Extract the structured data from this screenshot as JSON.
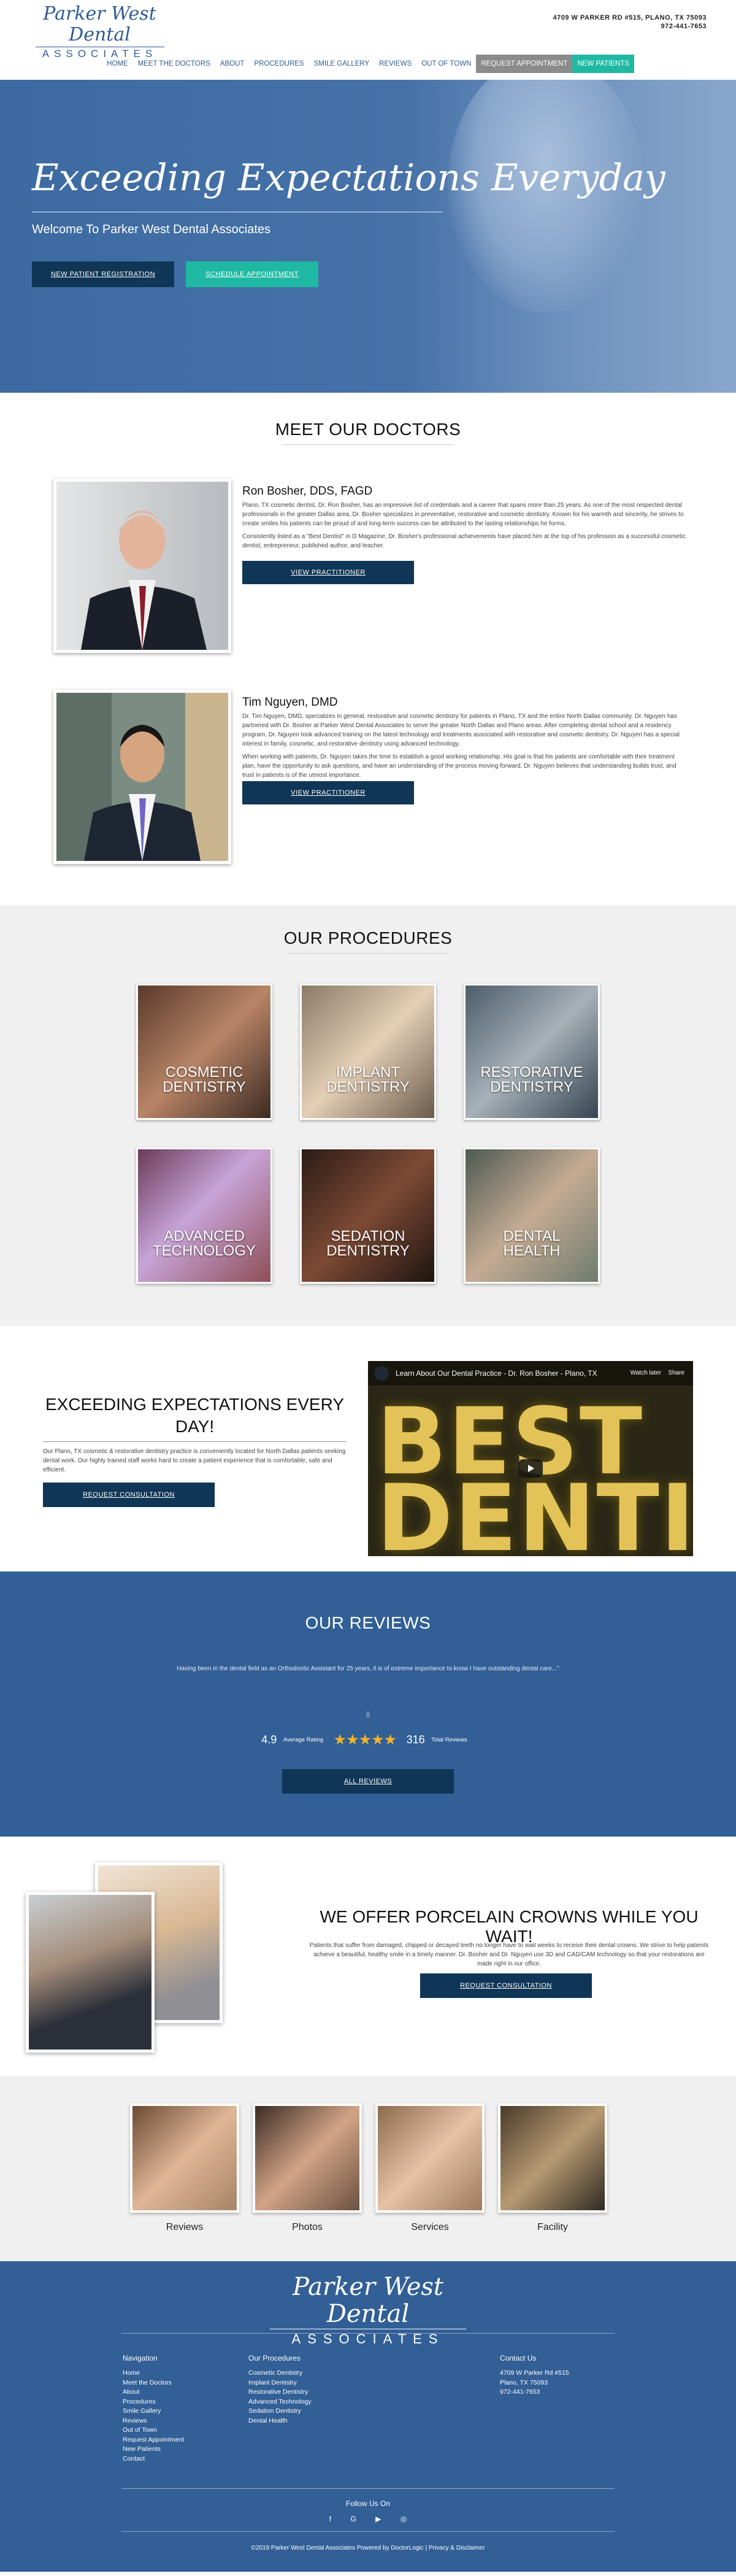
{
  "header": {
    "logo_script": "Parker West Dental",
    "logo_caps": "ASSOCIATES",
    "address_line1": "4709 W PARKER RD #515, PLANO, TX 75093",
    "phone": "972-441-7653"
  },
  "nav": {
    "items": [
      "HOME",
      "MEET THE DOCTORS",
      "ABOUT",
      "PROCEDURES",
      "SMILE GALLERY",
      "REVIEWS",
      "OUT OF TOWN"
    ],
    "request_appointment": "REQUEST APPOINTMENT",
    "new_patients": "NEW PATIENTS"
  },
  "hero": {
    "title": "Exceeding Expectations Everyday",
    "subtitle": "Welcome To Parker West Dental Associates",
    "btn_registration": "NEW PATIENT REGISTRATION",
    "btn_schedule": "SCHEDULE APPOINTMENT"
  },
  "doctors": {
    "title": "MEET OUR DOCTORS",
    "list": [
      {
        "name": "Ron Bosher, DDS, FAGD",
        "bio1": "Plano, TX cosmetic dentist, Dr. Ron Bosher, has an impressive list of credentials and a career that spans more than 25 years. As one of the most respected dental professionals in the greater Dallas area, Dr. Bosher specializes in preventative, restorative and cosmetic dentistry. Known for his warmth and sincerity, he strives to create smiles his patients can be proud of and long-term success can be attributed to the lasting relationships he forms.",
        "bio2": "Consistently listed as a \"Best Dentist\" in D Magazine, Dr. Bosher's professional achievements have placed him at the top of his profession as a successful cosmetic dentist, entrepreneur, published author, and teacher.",
        "button": "VIEW PRACTITIONER"
      },
      {
        "name": "Tim Nguyen, DMD",
        "bio1": "Dr. Tim Nguyen, DMD, specializes in general, restorative and cosmetic dentistry for patients in Plano, TX and the entire North Dallas community. Dr. Nguyen has partnered with Dr. Bosher at Parker West Dental Associates to serve the greater North Dallas and Plano areas. After completing dental school and a residency program, Dr. Nguyen took advanced training on the latest technology and treatments associated with restorative and cosmetic dentistry. Dr. Nguyen has a special interest in family, cosmetic, and restorative dentistry using advanced technology.",
        "bio2": "When working with patients, Dr. Nguyen takes the time to establish a good working relationship. His goal is that his patients are comfortable with their treatment plan, have the opportunity to ask questions, and have an understanding of the process moving forward. Dr. Nguyen believes that understanding builds trust, and trust in patients is of the utmost importance.",
        "button": "VIEW PRACTITIONER"
      }
    ]
  },
  "procedures": {
    "title": "OUR PROCEDURES",
    "items": [
      {
        "line1": "COSMETIC",
        "line2": "DENTISTRY"
      },
      {
        "line1": "IMPLANT",
        "line2": "DENTISTRY"
      },
      {
        "line1": "RESTORATIVE",
        "line2": "DENTISTRY"
      },
      {
        "line1": "ADVANCED",
        "line2": "TECHNOLOGY"
      },
      {
        "line1": "SEDATION",
        "line2": "DENTISTRY"
      },
      {
        "line1": "DENTAL",
        "line2": "HEALTH"
      }
    ]
  },
  "expectations": {
    "title": "EXCEEDING EXPECTATIONS EVERY DAY!",
    "text": "Our Plano, TX cosmetic & restorative dentistry practice is conveniently located for North Dallas patients seeking dental work. Our highly trained staff works hard to create a patient experience that is comfortable, safe and efficient.",
    "button": "REQUEST CONSULTATION",
    "video_title": "Learn About Our Dental Practice - Dr. Ron Bosher - Plano, TX",
    "video_watch": "Watch later",
    "video_share": "Share",
    "video_word1": "BEST",
    "video_word2": "DENTISTS"
  },
  "reviews": {
    "title": "OUR REVIEWS",
    "quote": "Having been in the dental field as an Orthodontic Assistant for 25 years, it is of extreme importance to know I have outstanding dental care...\"",
    "dots": "||",
    "rating": "4.9",
    "rating_label": "Average Rating",
    "stars": "★★★★★",
    "total": "316",
    "total_label": "Total Reviews",
    "button": "ALL REVIEWS"
  },
  "crowns": {
    "title": "WE OFFER PORCELAIN CROWNS WHILE YOU WAIT!",
    "text": "Patients that suffer from damaged, chipped or decayed teeth no longer have to wait weeks to receive their dental crowns. We strive to help patients achieve a beautiful, healthy smile in a timely manner. Dr. Bosher and Dr. Nguyen use 3D and CAD/CAM technology so that your restorations are made right in our office.",
    "button": "REQUEST CONSULTATION"
  },
  "galleries": {
    "items": [
      "Reviews",
      "Photos",
      "Services",
      "Facility"
    ]
  },
  "footer": {
    "logo_script": "Parker West Dental",
    "logo_caps": "ASSOCIATES",
    "nav_heading": "Navigation",
    "nav_links": [
      "Home",
      "Meet the Doctors",
      "About",
      "Procedures",
      "Smile Gallery",
      "Reviews",
      "Out of Town",
      "Request Appointment",
      "New Patients",
      "Contact"
    ],
    "proc_heading": "Our Procedures",
    "proc_links": [
      "Cosmetic Dentistry",
      "Implant Dentistry",
      "Restorative Dentistry",
      "Advanced Technology",
      "Sedation Dentistry",
      "Dental Health"
    ],
    "contact_heading": "Contact Us",
    "contact_lines": [
      "4709 W Parker Rd #515",
      "Plano, TX 75093",
      "972-441-7653"
    ],
    "follow": "Follow Us On",
    "social": [
      "f",
      "G",
      "▶",
      "◎"
    ],
    "copyright": "©2019 Parker West Dental Associates Powered by DoctorLogic | Privacy & Disclaimer"
  },
  "colors": {
    "brand_blue": "#325f96",
    "navy_button": "#0f3656",
    "teal_button": "#1fb9a3",
    "star_gold": "#f3b32a"
  }
}
